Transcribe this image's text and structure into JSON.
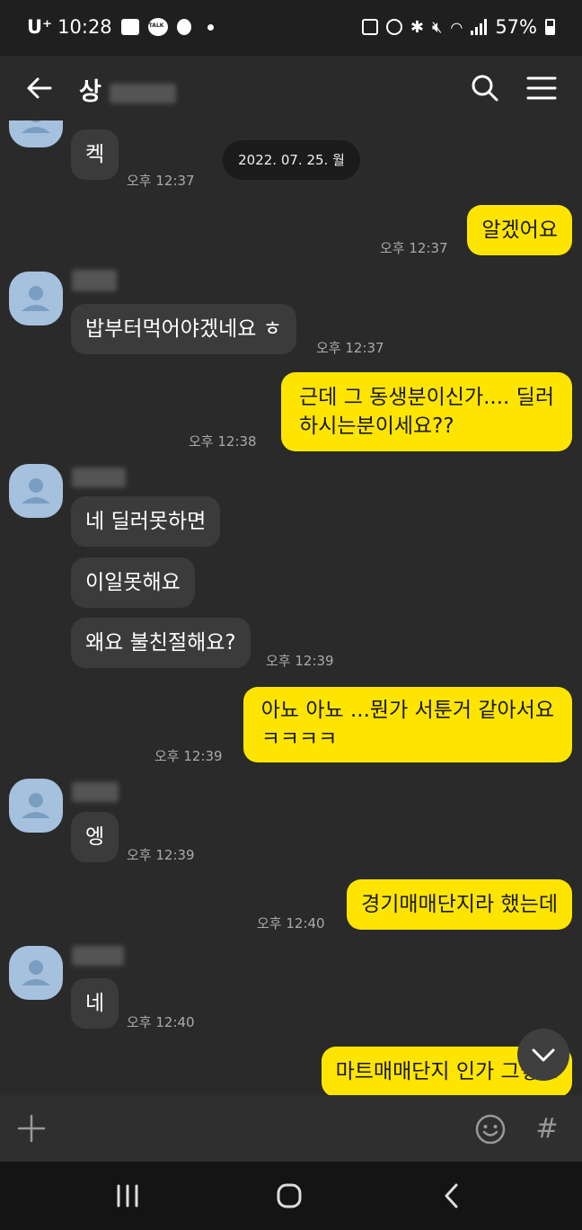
{
  "status_bar": {
    "carrier": "U⁺",
    "time": "10:28",
    "battery": "57%",
    "icons": [
      "gallery-icon",
      "kakaotalk-icon",
      "accessibility-icon",
      "dot-icon",
      "alarm-icon",
      "bluetooth-icon",
      "mute-icon",
      "wifi-icon",
      "signal-icon",
      "battery-icon"
    ]
  },
  "header": {
    "title": "상",
    "icons": [
      "back-arrow-icon",
      "search-icon",
      "menu-icon"
    ]
  },
  "chat": {
    "date_divider": "2022. 07. 25. 월",
    "messages": [
      {
        "from": "them",
        "text": "켁",
        "time": "오후 12:37"
      },
      {
        "from": "me",
        "text": "알겠어요",
        "time": "오후 12:37"
      },
      {
        "from": "them",
        "text": "밥부터먹어야겠네요 ㅎ",
        "time": "오후 12:37"
      },
      {
        "from": "me",
        "line1": "근데 그  동생분이신가.... 딜러",
        "line2": "하시는분이세요??",
        "time": "오후 12:38"
      },
      {
        "from": "them",
        "text": "네 딜러못하면"
      },
      {
        "from": "them",
        "text": "이일못해요"
      },
      {
        "from": "them",
        "text": "왜요 불친절해요?",
        "time": "오후 12:39"
      },
      {
        "from": "me",
        "line1": "아뇨 아뇨 ...뭔가 서툰거 같아서요",
        "line2": "ㅋㅋㅋㅋ",
        "time": "오후 12:39"
      },
      {
        "from": "them",
        "text": "엥",
        "time": "오후 12:39"
      },
      {
        "from": "me",
        "text": "경기매매단지라 했는데",
        "time": "오후 12:40"
      },
      {
        "from": "them",
        "text": "네",
        "time": "오후 12:40"
      },
      {
        "from": "me",
        "text": "마트매매단지 인가 그렇죠"
      }
    ]
  },
  "input_bar": {
    "hash": "#",
    "icons": [
      "plus-icon",
      "emoji-icon",
      "hashtag-icon"
    ]
  },
  "nav_bar": {
    "icons": [
      "recent-apps-icon",
      "home-icon",
      "back-icon"
    ]
  },
  "colors": {
    "background": "#2a2a2a",
    "incoming_bubble": "#3b3b3b",
    "outgoing_bubble": "#fee500",
    "avatar": "#a6c1de"
  }
}
